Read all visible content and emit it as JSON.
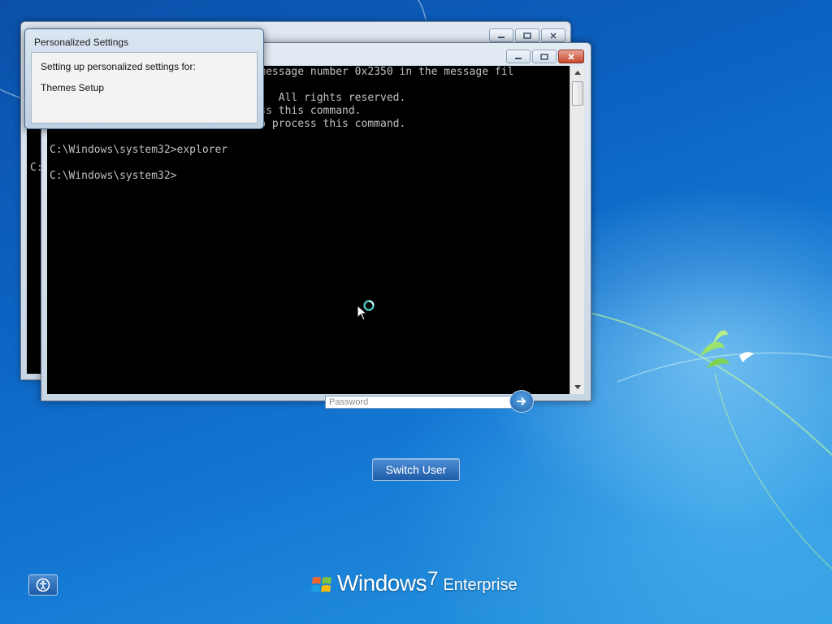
{
  "desktop": {
    "brand": {
      "name": "Windows",
      "version": "7",
      "edition": "Enterprise"
    },
    "logon": {
      "password_placeholder": "Password",
      "switch_user_label": "Switch User"
    }
  },
  "back_console": {
    "visible_prompt_fragment": "C:"
  },
  "console": {
    "lines": [
      "                          xt for message number 0x2350 in the message fil",
      "",
      "                          oration.  All rights reserved.",
      "                          o process this command.",
      "Not enough storage is available to process this command.",
      "",
      "C:\\Windows\\system32>explorer",
      "",
      "C:\\Windows\\system32>"
    ]
  },
  "personalized_dialog": {
    "title": "Personalized Settings",
    "line1": "Setting up personalized settings for:",
    "line2": "Themes Setup"
  },
  "colors": {
    "console_bg": "#000000",
    "console_text": "#c0c0c0",
    "close_button": "#c8472e"
  }
}
